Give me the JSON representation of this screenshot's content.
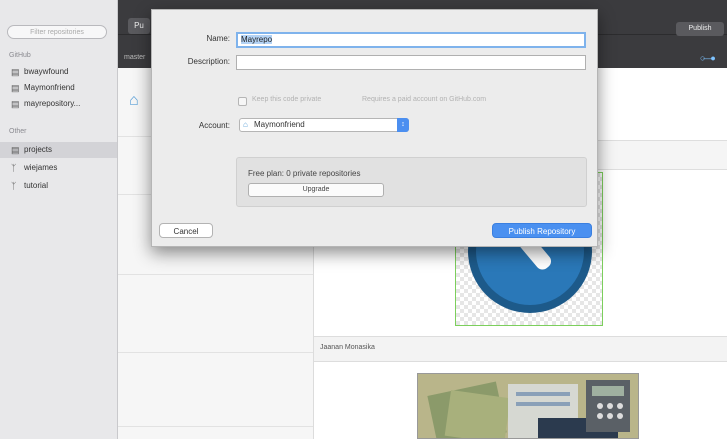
{
  "sidebar": {
    "search_placeholder": "Filter repositories",
    "sections": [
      {
        "title": "GitHub",
        "items": [
          {
            "label": "bwaywfound",
            "icon": "repo-icon"
          },
          {
            "label": "Maymonfriend",
            "icon": "repo-icon"
          },
          {
            "label": "mayrepository...",
            "icon": "repo-icon"
          }
        ]
      },
      {
        "title": "Other",
        "items": [
          {
            "label": "projects",
            "icon": "repo-icon",
            "selected": true
          },
          {
            "label": "wiejames",
            "icon": "branch-icon"
          },
          {
            "label": "tutorial",
            "icon": "branch-icon"
          }
        ]
      }
    ]
  },
  "toolbar": {
    "left_button": "Pu",
    "right_button": "Publish",
    "sub_text": "master"
  },
  "content": {
    "caption": "Jaanan Monasika"
  },
  "dialog": {
    "name_label": "Name:",
    "name_value": "Mayrepo",
    "description_label": "Description:",
    "description_value": "",
    "keep_private_label": "Keep this code private",
    "keep_private_hint": "Requires a paid account on GitHub.com",
    "account_label": "Account:",
    "account_value": "Maymonfriend",
    "plan_text": "Free plan: 0 private repositories",
    "upgrade_label": "Upgrade",
    "cancel_label": "Cancel",
    "publish_label": "Publish Repository"
  },
  "colors": {
    "accent": "#4a90f0",
    "toolbar_dark": "#3b3b3e"
  }
}
